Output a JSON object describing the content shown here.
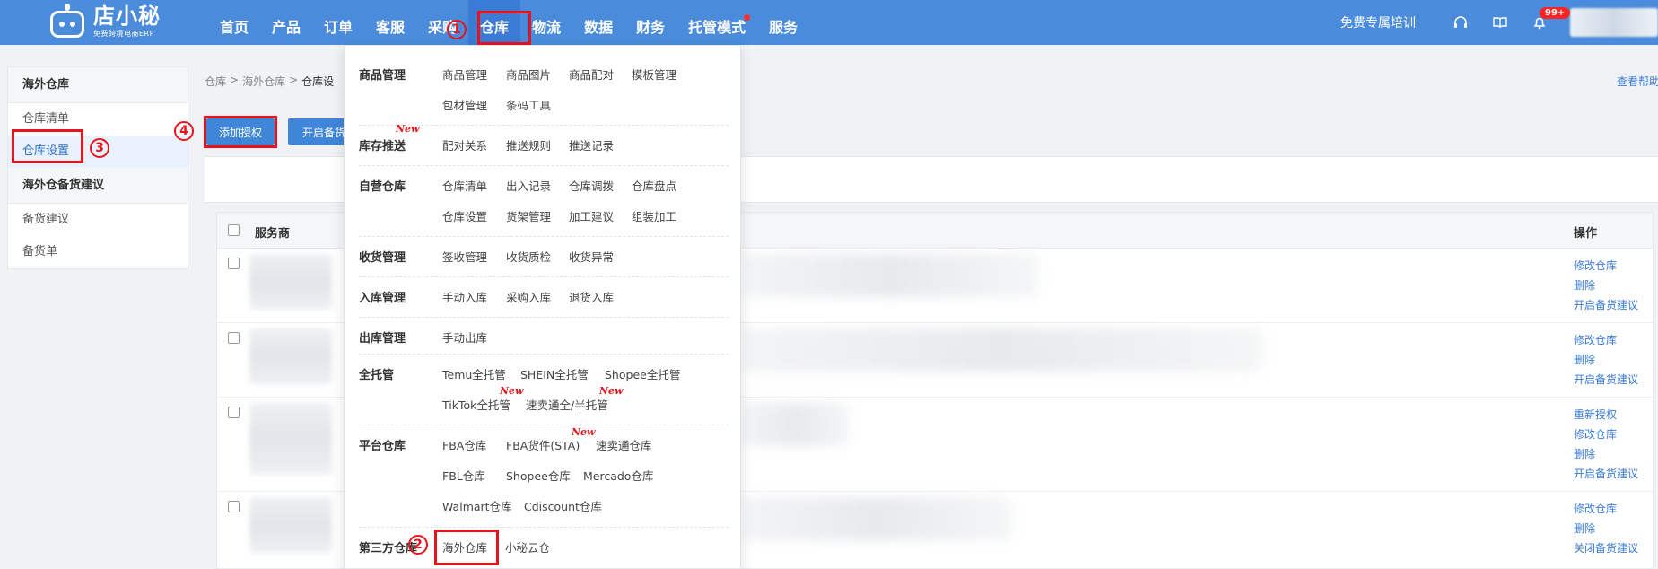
{
  "logo": {
    "name": "店小秘",
    "subtitle": "免费跨境电商ERP"
  },
  "nav": {
    "items": [
      "首页",
      "产品",
      "订单",
      "客服",
      "采购",
      "仓库",
      "物流",
      "数据",
      "财务",
      "托管模式",
      "服务"
    ],
    "active": "仓库"
  },
  "top_right": {
    "training": "免费专属培训",
    "badge": "99+"
  },
  "sidebar": {
    "group1": "海外仓库",
    "item_list": "仓库清单",
    "item_settings": "仓库设置",
    "group2": "海外仓备货建议",
    "item_suggest": "备货建议",
    "item_order": "备货单"
  },
  "breadcrumb": {
    "a": "仓库",
    "sep": ">",
    "b": "海外仓库",
    "c": "仓库设"
  },
  "help_link": "查看帮助",
  "buttons": {
    "add_auth": "添加授权",
    "open_stock": "开启备货"
  },
  "table": {
    "col_provider": "服务商",
    "col_ops": "操作",
    "rows": [
      {
        "ops": [
          "修改仓库",
          "删除",
          "开启备货建议"
        ]
      },
      {
        "ops": [
          "修改仓库",
          "删除",
          "开启备货建议"
        ]
      },
      {
        "ops": [
          "重新授权",
          "修改仓库",
          "删除",
          "开启备货建议"
        ]
      },
      {
        "ops": [
          "修改仓库",
          "删除",
          "关闭备货建议"
        ]
      }
    ]
  },
  "menu": {
    "goods": {
      "title": "商品管理",
      "links": [
        "商品管理",
        "商品图片",
        "商品配对",
        "模板管理",
        "包材管理",
        "条码工具"
      ]
    },
    "push": {
      "title": "库存推送",
      "links": [
        "配对关系",
        "推送规则",
        "推送记录"
      ]
    },
    "own": {
      "title": "自营仓库",
      "links": [
        "仓库清单",
        "出入记录",
        "仓库调拨",
        "仓库盘点",
        "仓库设置",
        "货架管理",
        "加工建议",
        "组装加工"
      ]
    },
    "receive": {
      "title": "收货管理",
      "links": [
        "签收管理",
        "收货质检",
        "收货异常"
      ]
    },
    "inbound": {
      "title": "入库管理",
      "links": [
        "手动入库",
        "采购入库",
        "退货入库"
      ]
    },
    "outbound": {
      "title": "出库管理",
      "links": [
        "手动出库"
      ]
    },
    "full": {
      "title": "全托管",
      "links": [
        "Temu全托管",
        "SHEIN全托管",
        "Shopee全托管",
        "TikTok全托管",
        "速卖通全/半托管"
      ]
    },
    "platform": {
      "title": "平台仓库",
      "links": [
        "FBA仓库",
        "FBA货件(STA)",
        "速卖通仓库",
        "FBL仓库",
        "Shopee仓库",
        "Mercado仓库",
        "Walmart仓库",
        "Cdiscount仓库"
      ]
    },
    "third": {
      "title": "第三方仓库",
      "links": [
        "海外仓库",
        "小秘云仓"
      ]
    },
    "new_tag": "New"
  },
  "annotations": {
    "n1": "1",
    "n2": "2",
    "n3": "3",
    "n4": "4"
  }
}
